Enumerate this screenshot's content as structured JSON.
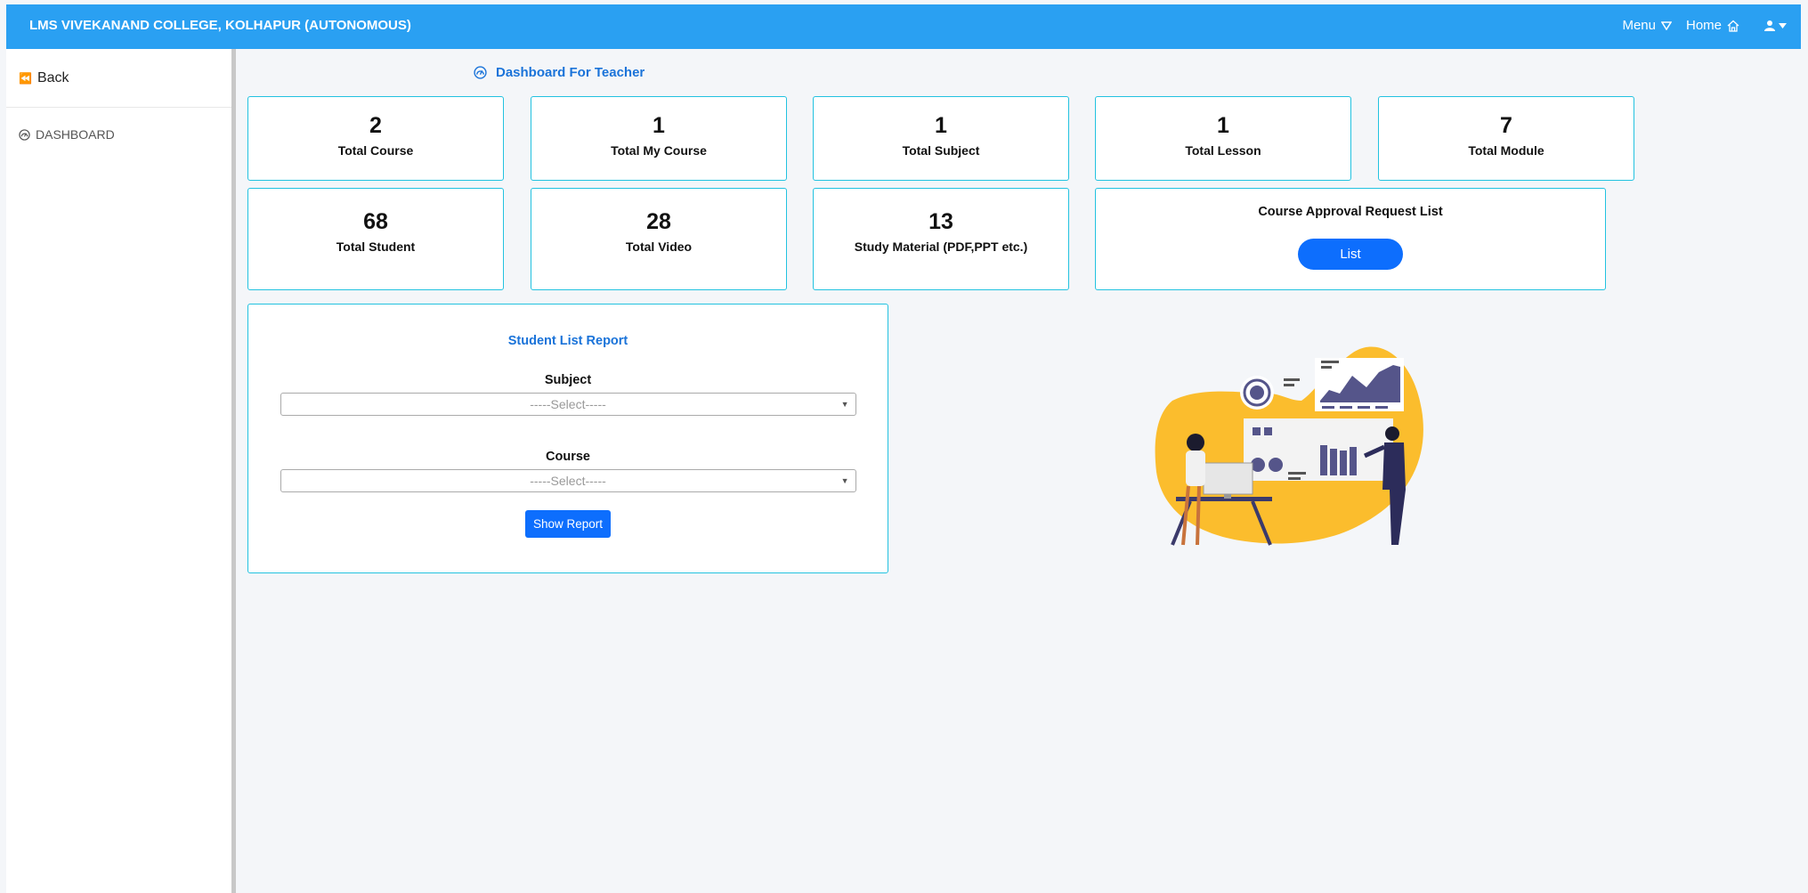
{
  "header": {
    "brand": "LMS VIVEKANAND COLLEGE, KOLHAPUR (AUTONOMOUS)",
    "menu_label": "Menu",
    "home_label": "Home"
  },
  "sidebar": {
    "back_label": "Back",
    "dashboard_label": "DASHBOARD"
  },
  "page_title": "Dashboard For Teacher",
  "stats": {
    "total_course": {
      "value": "2",
      "label": "Total Course"
    },
    "total_my_course": {
      "value": "1",
      "label": "Total My Course"
    },
    "total_subject": {
      "value": "1",
      "label": "Total Subject"
    },
    "total_lesson": {
      "value": "1",
      "label": "Total Lesson"
    },
    "total_module": {
      "value": "7",
      "label": "Total Module"
    },
    "total_student": {
      "value": "68",
      "label": "Total Student"
    },
    "total_video": {
      "value": "28",
      "label": "Total Video"
    },
    "study_material": {
      "value": "13",
      "label": "Study Material (PDF,PPT etc.)"
    }
  },
  "approval": {
    "title": "Course Approval Request List",
    "button": "List"
  },
  "report": {
    "title": "Student List Report",
    "subject_label": "Subject",
    "subject_value": "-----Select-----",
    "course_label": "Course",
    "course_value": "-----Select-----",
    "button": "Show Report"
  },
  "colors": {
    "header_bg": "#2aa0f2",
    "accent": "#0d6efd",
    "card_border": "#22c2e0",
    "illustration_yellow": "#fbbd2d",
    "illustration_navy": "#3b3a6b"
  }
}
